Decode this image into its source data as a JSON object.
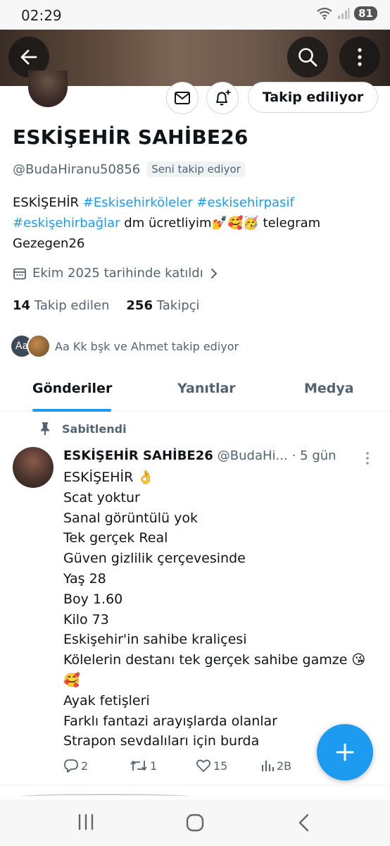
{
  "status_bar": {
    "time": "02:29",
    "battery": "81"
  },
  "header": {
    "icons": [
      "back-arrow-icon",
      "search-icon",
      "more-vertical-icon"
    ]
  },
  "profile": {
    "follow_button": "Takip ediliyor",
    "name": "ESKİŞEHİR SAHİBE26",
    "handle": "@BudaHiranu50856",
    "follows_you": "Seni takip ediyor",
    "bio": {
      "prefix": "ESKİŞEHİR ",
      "tag1": "#Eskisehirköleler",
      "tag2": "#eskisehirpasif",
      "tag3": "#eskişehirbağlar",
      "text": " dm  ücretliyim💅🥰🥳 telegram",
      "line3": "Gezegen26"
    },
    "joined": "Ekim 2025 tarihinde katıldı",
    "following_count": "14",
    "following_label": "Takip edilen",
    "followers_count": "256",
    "followers_label": "Takipçi",
    "followed_by_avatar_text": "Aa",
    "followed_by": "Aa Kk bşk ve Ahmet takip ediyor"
  },
  "tabs": [
    {
      "label": "Gönderiler",
      "active": true
    },
    {
      "label": "Yanıtlar",
      "active": false
    },
    {
      "label": "Medya",
      "active": false
    }
  ],
  "pinned_post": {
    "pinned_label": "Sabitlendi",
    "author_name": "ESKİŞEHİR SAHİBE26",
    "author_handle": "@BudaHi...",
    "time": "· 5 gün",
    "lines": [
      "ESKİŞEHİR 👌",
      "Scat yoktur",
      "Sanal görüntülü yok",
      "Tek gerçek Real",
      "Güven gizlilik çerçevesinde",
      "Yaş 28",
      "Boy 1.60",
      "Kilo 73",
      "Eskişehir'in sahibe kraliçesi",
      "Kölelerin destanı tek gerçek sahibe gamze 😘",
      "🥰",
      "Ayak fetişleri",
      "Farklı fantazi arayışlarda olanlar",
      "Strapon sevdalıları için burda"
    ],
    "replies": "2",
    "reposts": "1",
    "likes": "15",
    "views": "2B"
  },
  "colors": {
    "accent": "#1d9bf0",
    "text": "#0f1419",
    "muted": "#536471"
  }
}
